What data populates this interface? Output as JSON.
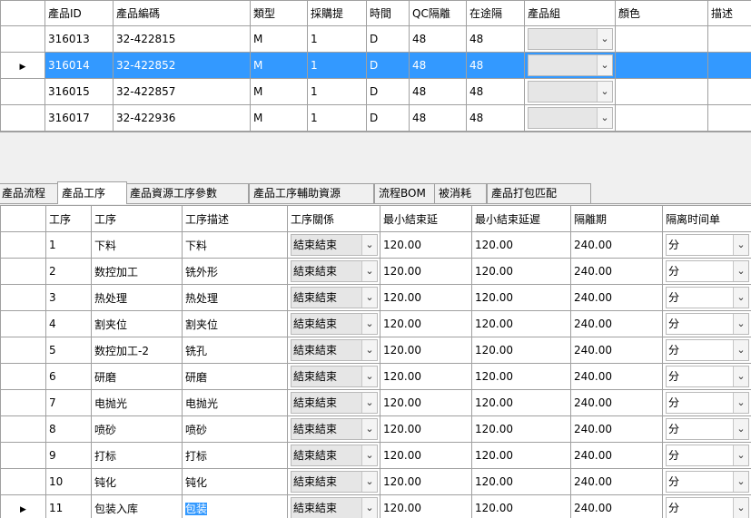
{
  "top_grid": {
    "headers": [
      "產品ID",
      "產品編碼",
      "類型",
      "採購提",
      "時間",
      "QC隔離",
      "在途隔",
      "產品組",
      "顏色",
      "描述"
    ],
    "rows": [
      {
        "id": "316013",
        "code": "32-422815",
        "type": "M",
        "lead": "1",
        "unit": "D",
        "qc": "48",
        "transit": "48",
        "group": "",
        "color": "",
        "desc": "",
        "selected": false
      },
      {
        "id": "316014",
        "code": "32-422852",
        "type": "M",
        "lead": "1",
        "unit": "D",
        "qc": "48",
        "transit": "48",
        "group": "",
        "color": "",
        "desc": "",
        "selected": true
      },
      {
        "id": "316015",
        "code": "32-422857",
        "type": "M",
        "lead": "1",
        "unit": "D",
        "qc": "48",
        "transit": "48",
        "group": "",
        "color": "",
        "desc": "",
        "selected": false
      },
      {
        "id": "316017",
        "code": "32-422936",
        "type": "M",
        "lead": "1",
        "unit": "D",
        "qc": "48",
        "transit": "48",
        "group": "",
        "color": "",
        "desc": "",
        "selected": false
      }
    ]
  },
  "tabs": [
    "產品流程",
    "產品工序",
    "產品資源工序參數",
    "產品工序輔助資源",
    "流程BOM",
    "被消耗",
    "產品打包匹配"
  ],
  "active_tab": 1,
  "process_grid": {
    "headers": [
      "工序",
      "工序",
      "工序描述",
      "工序關係",
      "最小結束延",
      "最小結束延遲",
      "隔離期",
      "隔离时间单"
    ],
    "rows": [
      {
        "seq": "1",
        "name": "下料",
        "desc": "下料",
        "relation": "結束結束",
        "min_end": "120.00",
        "min_end_delay": "120.00",
        "isolation": "240.00",
        "unit": "分"
      },
      {
        "seq": "2",
        "name": "数控加工",
        "desc": "铣外形",
        "relation": "結束結束",
        "min_end": "120.00",
        "min_end_delay": "120.00",
        "isolation": "240.00",
        "unit": "分"
      },
      {
        "seq": "3",
        "name": "热处理",
        "desc": "热处理",
        "relation": "結束結束",
        "min_end": "120.00",
        "min_end_delay": "120.00",
        "isolation": "240.00",
        "unit": "分"
      },
      {
        "seq": "4",
        "name": "割夹位",
        "desc": "割夹位",
        "relation": "結束結束",
        "min_end": "120.00",
        "min_end_delay": "120.00",
        "isolation": "240.00",
        "unit": "分"
      },
      {
        "seq": "5",
        "name": "数控加工-2",
        "desc": "铣孔",
        "relation": "結束結束",
        "min_end": "120.00",
        "min_end_delay": "120.00",
        "isolation": "240.00",
        "unit": "分"
      },
      {
        "seq": "6",
        "name": "研磨",
        "desc": "研磨",
        "relation": "結束結束",
        "min_end": "120.00",
        "min_end_delay": "120.00",
        "isolation": "240.00",
        "unit": "分"
      },
      {
        "seq": "7",
        "name": "电抛光",
        "desc": "电抛光",
        "relation": "結束結束",
        "min_end": "120.00",
        "min_end_delay": "120.00",
        "isolation": "240.00",
        "unit": "分"
      },
      {
        "seq": "8",
        "name": "喷砂",
        "desc": "喷砂",
        "relation": "結束結束",
        "min_end": "120.00",
        "min_end_delay": "120.00",
        "isolation": "240.00",
        "unit": "分"
      },
      {
        "seq": "9",
        "name": "打标",
        "desc": "打标",
        "relation": "結束結束",
        "min_end": "120.00",
        "min_end_delay": "120.00",
        "isolation": "240.00",
        "unit": "分"
      },
      {
        "seq": "10",
        "name": "钝化",
        "desc": "钝化",
        "relation": "結束結束",
        "min_end": "120.00",
        "min_end_delay": "120.00",
        "isolation": "240.00",
        "unit": "分"
      },
      {
        "seq": "11",
        "name": "包装入库",
        "desc": "包装",
        "relation": "結束結束",
        "min_end": "120.00",
        "min_end_delay": "120.00",
        "isolation": "240.00",
        "unit": "分",
        "current": true
      }
    ]
  },
  "icons": {
    "row_indicator": "row-indicator-icon",
    "dropdown": "chevron-down-icon"
  },
  "colors": {
    "selection": "#3399ff",
    "header_bg": "#ffffff",
    "panel_bg": "#f0f0f0"
  }
}
